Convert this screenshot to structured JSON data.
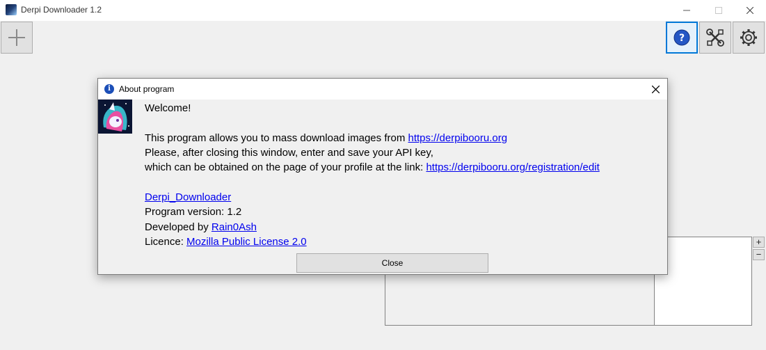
{
  "window": {
    "title": "Derpi Downloader 1.2"
  },
  "toolbar": {
    "add_icon": "plus-icon",
    "help_icon": "question-icon",
    "tools_icon": "tools-icon",
    "settings_icon": "gear-icon"
  },
  "dialog": {
    "title": "About program",
    "welcome": "Welcome!",
    "line1_text": "This program allows you to mass download images from ",
    "line1_link": "https://derpibooru.org",
    "line2_text": "Please, after closing this window, enter and save your API key,",
    "line3_text": "which can be obtained on the page of your profile at the link: ",
    "line3_link": "https://derpibooru.org/registration/edit",
    "app_link": "Derpi_Downloader",
    "version_text": "Program version: 1.2",
    "developed_text": "Developed by ",
    "developer_link": "Rain0Ash",
    "licence_text": "Licence: ",
    "licence_link": "Mozilla Public License 2.0",
    "close_label": "Close"
  },
  "side": {
    "plus_label": "+",
    "minus_label": "−"
  },
  "colors": {
    "accent": "#0078d7",
    "link": "#0000ee",
    "info_icon": "#1c4fb8"
  }
}
